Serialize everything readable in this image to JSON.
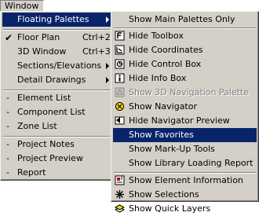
{
  "menubar": {
    "title": "Window"
  },
  "window_menu": {
    "items": [
      {
        "label": "Floating Palettes"
      },
      {
        "label": "Floor Plan",
        "shortcut": "Ctrl+2"
      },
      {
        "label": "3D Window",
        "shortcut": "Ctrl+3"
      },
      {
        "label": "Sections/Elevations"
      },
      {
        "label": "Detail Drawings"
      },
      {
        "label": "Element List"
      },
      {
        "label": "Component List"
      },
      {
        "label": "Zone List"
      },
      {
        "label": "Project Notes"
      },
      {
        "label": "Project Preview"
      },
      {
        "label": "Report"
      }
    ]
  },
  "palettes_menu": {
    "items": [
      {
        "label": "Show Main Palettes Only"
      },
      {
        "label": "Hide Toolbox"
      },
      {
        "label": "Hide Coordinates"
      },
      {
        "label": "Hide Control Box"
      },
      {
        "label": "Hide Info Box"
      },
      {
        "label": "Show 3D Navigation Palette"
      },
      {
        "label": "Show Navigator"
      },
      {
        "label": "Hide Navigator Preview"
      },
      {
        "label": "Show Favorites"
      },
      {
        "label": "Show Mark-Up Tools"
      },
      {
        "label": "Show Library Loading Report"
      },
      {
        "label": "Show Element Information"
      },
      {
        "label": "Show Selections"
      },
      {
        "label": "Show Quick Layers"
      }
    ]
  },
  "colors": {
    "menu_bg": "#d4d0c8",
    "highlight": "#0a246a"
  }
}
